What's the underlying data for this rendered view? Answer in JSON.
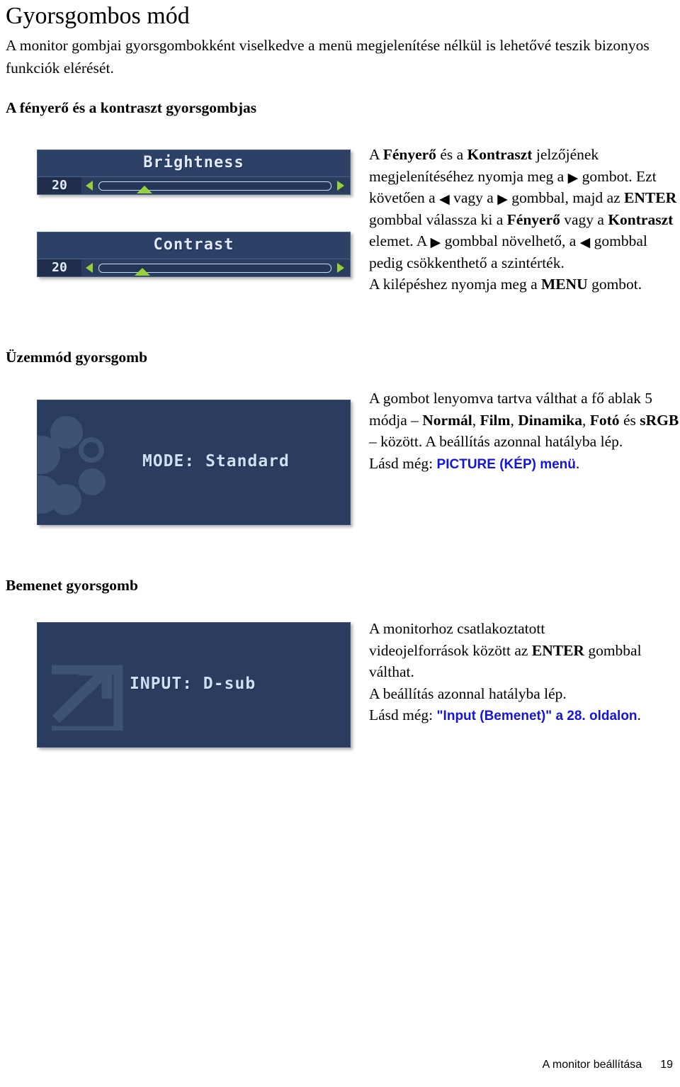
{
  "page": {
    "title": "Gyorsgombos mód",
    "intro": "A monitor gombjai gyorsgombokként viselkedve a menü megjelenítése nélkül is lehetővé teszik bizonyos funkciók elérését.",
    "footer_label": "A monitor beállítása",
    "footer_page": "19"
  },
  "colors": {
    "osd_background": "#2a3d5f",
    "osd_value_background": "#1e2e4b",
    "osd_text": "#dfe9f7",
    "osd_accent_green": "#96d13c",
    "deco_circle": "#3e5274",
    "link": "#1414dc"
  },
  "sections": {
    "brightness": {
      "heading": "A fényerő és a kontraszt gyorsgombjas",
      "text": {
        "l1_a": "A ",
        "l1_b1": "Fényerő",
        "l1_c": " és a ",
        "l1_b2": "Kontraszt",
        "l1_d": " jelzőjének",
        "l2_a": "megjelenítéséhez nyomja meg a ",
        "l2_arrow": "▶",
        "l2_b": " gombot.",
        "l3_a": "Ezt követően a ",
        "l3_arrow1": "◀",
        "l3_b": " vagy a ",
        "l3_arrow2": "▶",
        "l3_c": " gombbal, majd",
        "l4_a": "az ",
        "l4_b1": "ENTER",
        "l4_c": " gombbal válassza ki a ",
        "l4_b2": "Fényerő",
        "l5_a": "vagy a ",
        "l5_b1": "Kontraszt",
        "l5_c": " elemet. A ",
        "l5_arrow": "▶",
        "l5_d": " gombbal",
        "l6_a": "növelhető, a ",
        "l6_arrow": "◀",
        "l6_b": " gombbal pedig csökkenthető",
        "l7_a": "a szintérték.",
        "l8_a": "A kilépéshez nyomja meg a ",
        "l8_b1": "MENU",
        "l8_c": " gombot."
      },
      "osd_brightness": {
        "title": "Brightness",
        "value": "20"
      },
      "osd_contrast": {
        "title": "Contrast",
        "value": "20"
      }
    },
    "mode": {
      "heading": "Üzemmód gyorsgomb",
      "osd_label": "MODE: Standard",
      "text": {
        "l1": "A gombot lenyomva tartva válthat a fő ablak",
        "l2_a": "5 módja – ",
        "l2_b1": "Normál",
        "l2_c1": ", ",
        "l2_b2": "Film",
        "l2_c2": ", ",
        "l2_b3": "Dinamika",
        "l2_c3": ", ",
        "l2_b4": "Fotó",
        "l3_a": "és ",
        "l3_b1": "sRGB",
        "l3_c": " – között. A beállítás azonnal",
        "l4": "hatályba lép.",
        "l5_a": "Lásd még: ",
        "l5_link": "PICTURE (KÉP) menü",
        "l5_b": "."
      }
    },
    "input": {
      "heading": "Bemenet gyorsgomb",
      "osd_label": "INPUT: D-sub",
      "text": {
        "l1": "A monitorhoz csatlakoztatott",
        "l2_a": "videojelforrások között az ",
        "l2_b1": "ENTER",
        "l2_c": " gombbal",
        "l3": "válthat.",
        "l4": "A beállítás azonnal hatályba lép.",
        "l5_a": "Lásd még: ",
        "l5_link": "\"Input (Bemenet)\" a 28. oldalon",
        "l5_b": "."
      }
    }
  }
}
